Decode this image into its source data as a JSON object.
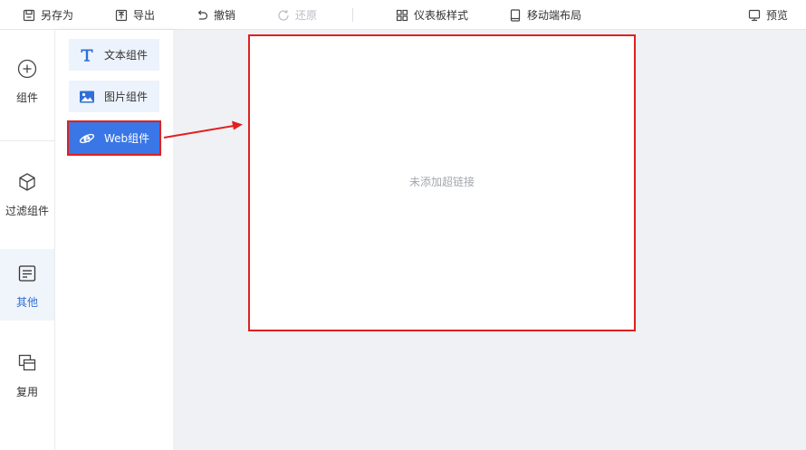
{
  "toolbar": {
    "save_as": "另存为",
    "export": "导出",
    "undo": "撤销",
    "redo": "还原",
    "dashboard_style": "仪表板样式",
    "mobile_layout": "移动端布局",
    "preview": "预览"
  },
  "rail": {
    "items": [
      {
        "label": "组件",
        "icon": "plus-circle-icon"
      },
      {
        "label": "过滤组件",
        "icon": "cube-icon"
      },
      {
        "label": "其他",
        "icon": "document-icon",
        "active": true
      },
      {
        "label": "复用",
        "icon": "copy-icon"
      }
    ]
  },
  "components": {
    "items": [
      {
        "label": "文本组件",
        "icon": "text-icon"
      },
      {
        "label": "图片组件",
        "icon": "image-icon"
      },
      {
        "label": "Web组件",
        "icon": "web-icon",
        "active": true
      }
    ]
  },
  "canvas": {
    "web_placeholder": "未添加超链接"
  },
  "colors": {
    "accent": "#3a76e6",
    "highlight": "#e02020",
    "canvas_bg": "#f0f1f5"
  }
}
